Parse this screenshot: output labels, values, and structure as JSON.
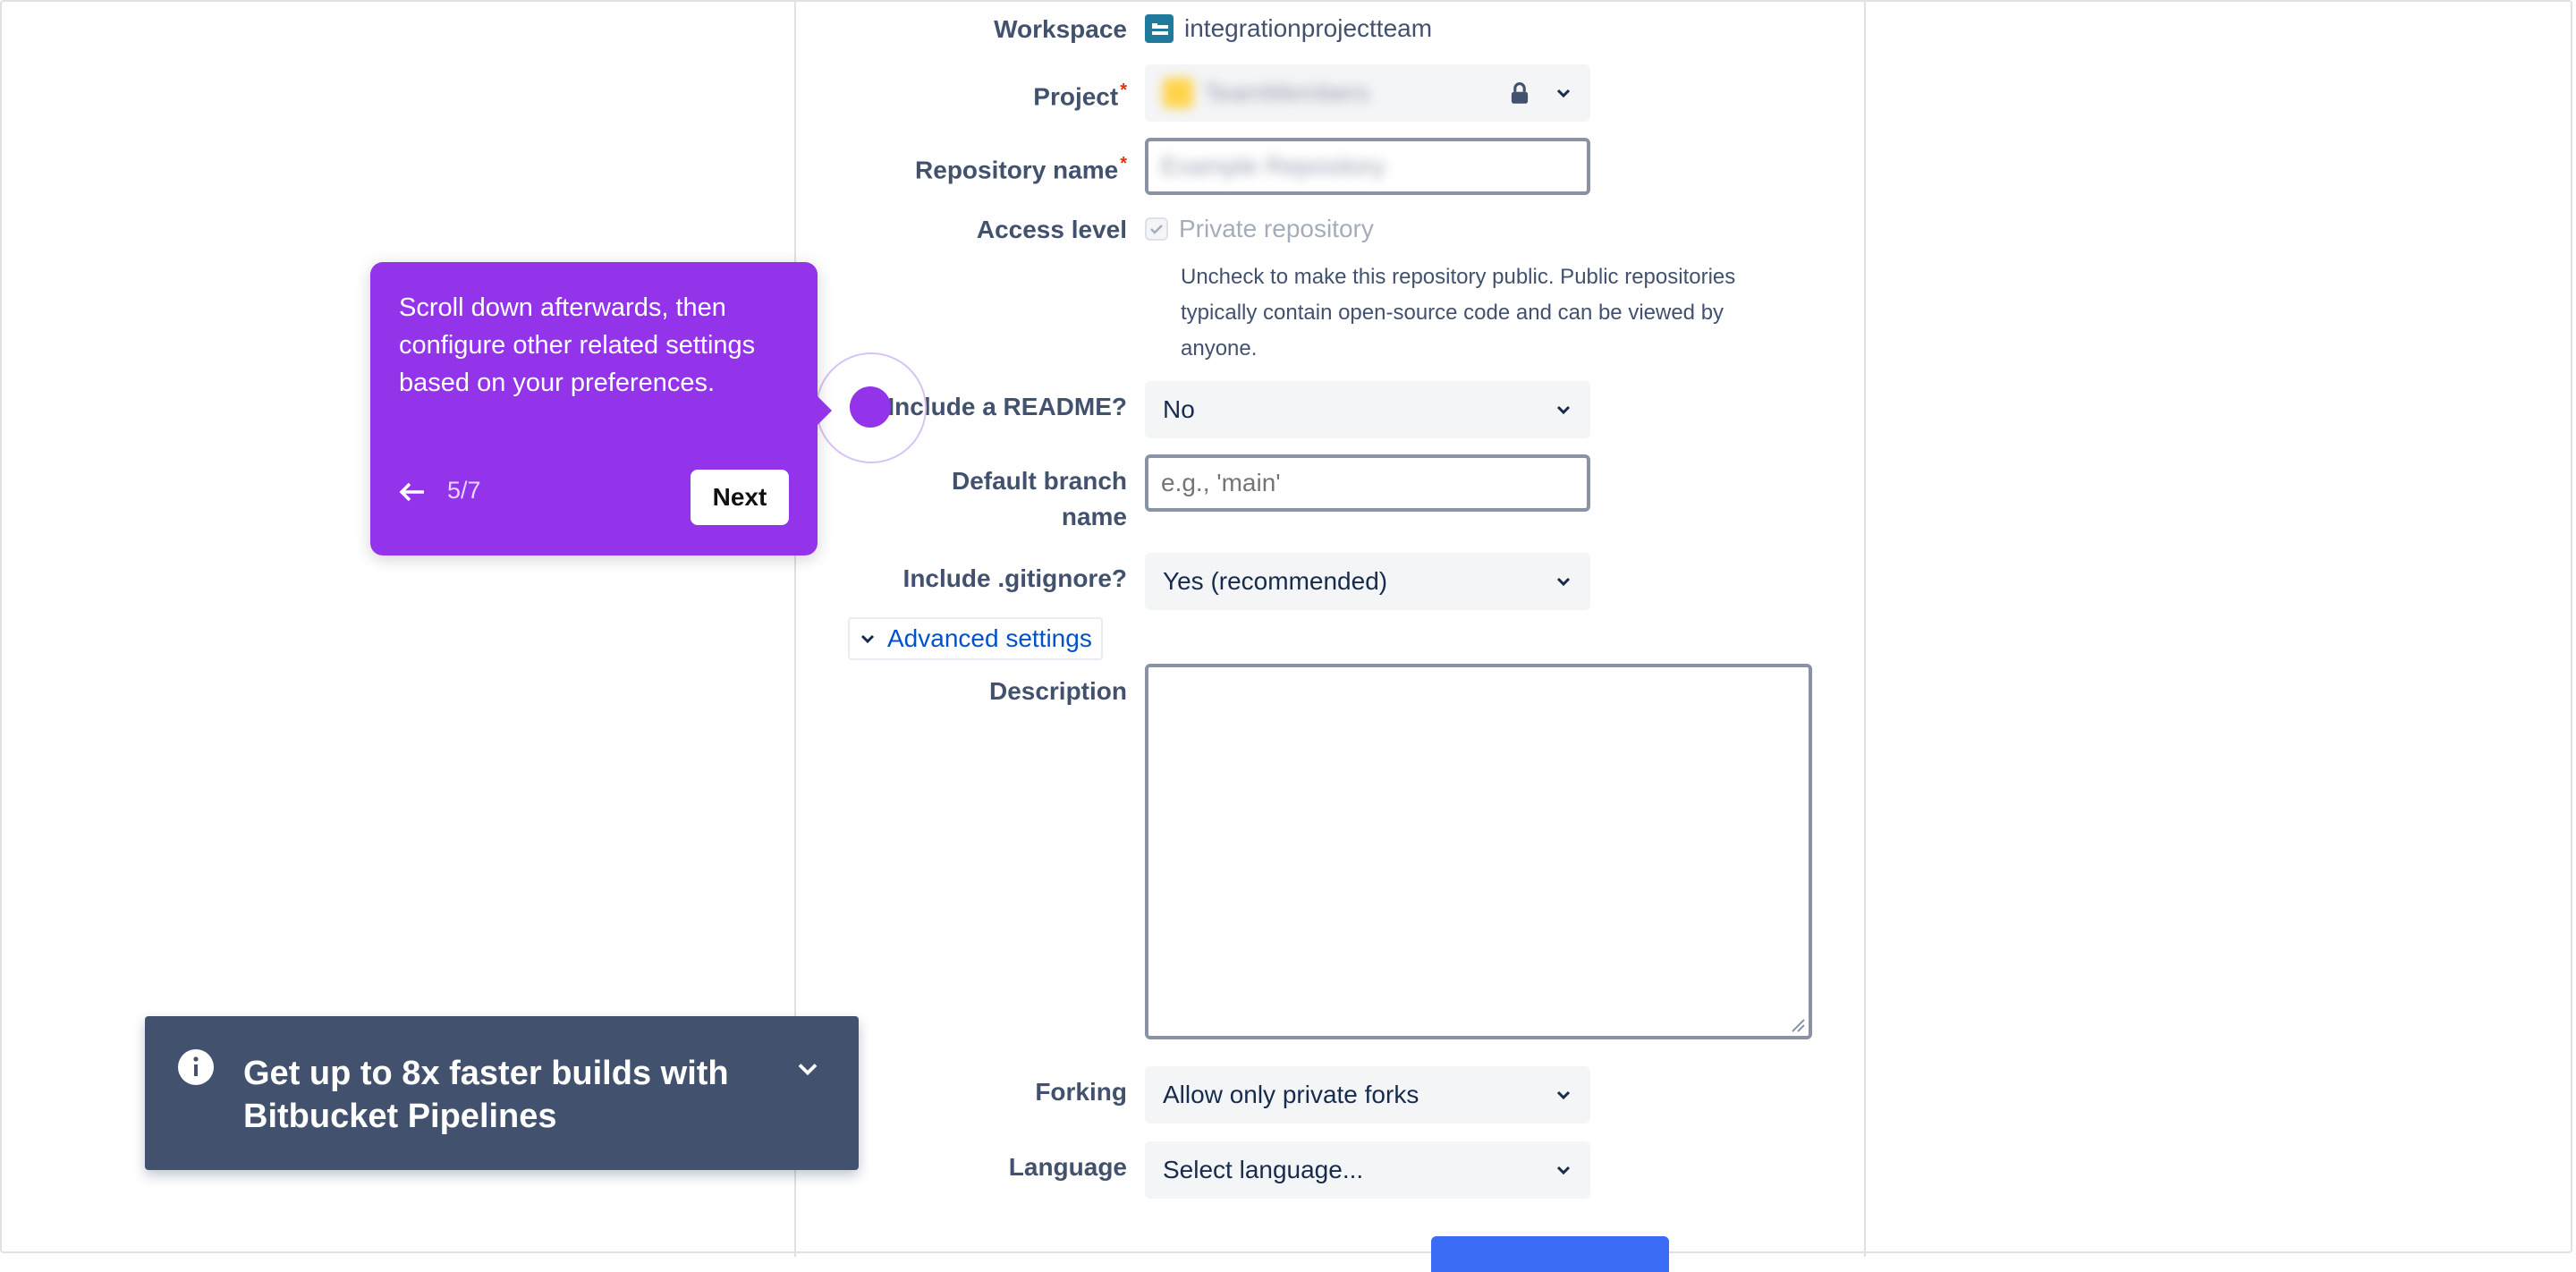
{
  "form": {
    "workspace": {
      "label": "Workspace",
      "value": "integrationprojectteam"
    },
    "project": {
      "label": "Project",
      "value": "TeamMembers"
    },
    "repository_name": {
      "label": "Repository name",
      "value": "Example Repository"
    },
    "access_level": {
      "label": "Access level",
      "checkbox_label": "Private repository",
      "checked": true,
      "help_lines": [
        "Uncheck to make this repository public. Public repositories",
        "typically contain open-source code and can be viewed by",
        "anyone."
      ]
    },
    "readme": {
      "label": "Include a README?",
      "value": "No"
    },
    "default_branch": {
      "label_line1": "Default branch",
      "label_line2": "name",
      "placeholder": "e.g., 'main'"
    },
    "gitignore": {
      "label": "Include .gitignore?",
      "value": "Yes (recommended)"
    },
    "advanced": {
      "label": "Advanced settings"
    },
    "description": {
      "label": "Description"
    },
    "forking": {
      "label": "Forking",
      "value": "Allow only private forks"
    },
    "language": {
      "label": "Language",
      "value": "Select language..."
    }
  },
  "tour": {
    "text": "Scroll down afterwards, then configure other related settings based on your preferences.",
    "step": "5/7",
    "next_label": "Next"
  },
  "banner": {
    "text": "Get up to 8x faster builds with Bitbucket Pipelines"
  },
  "colors": {
    "tour_purple": "#9333ea",
    "banner_bg": "#42526e",
    "link_blue": "#0052cc",
    "primary_blue": "#3b6cf5"
  }
}
